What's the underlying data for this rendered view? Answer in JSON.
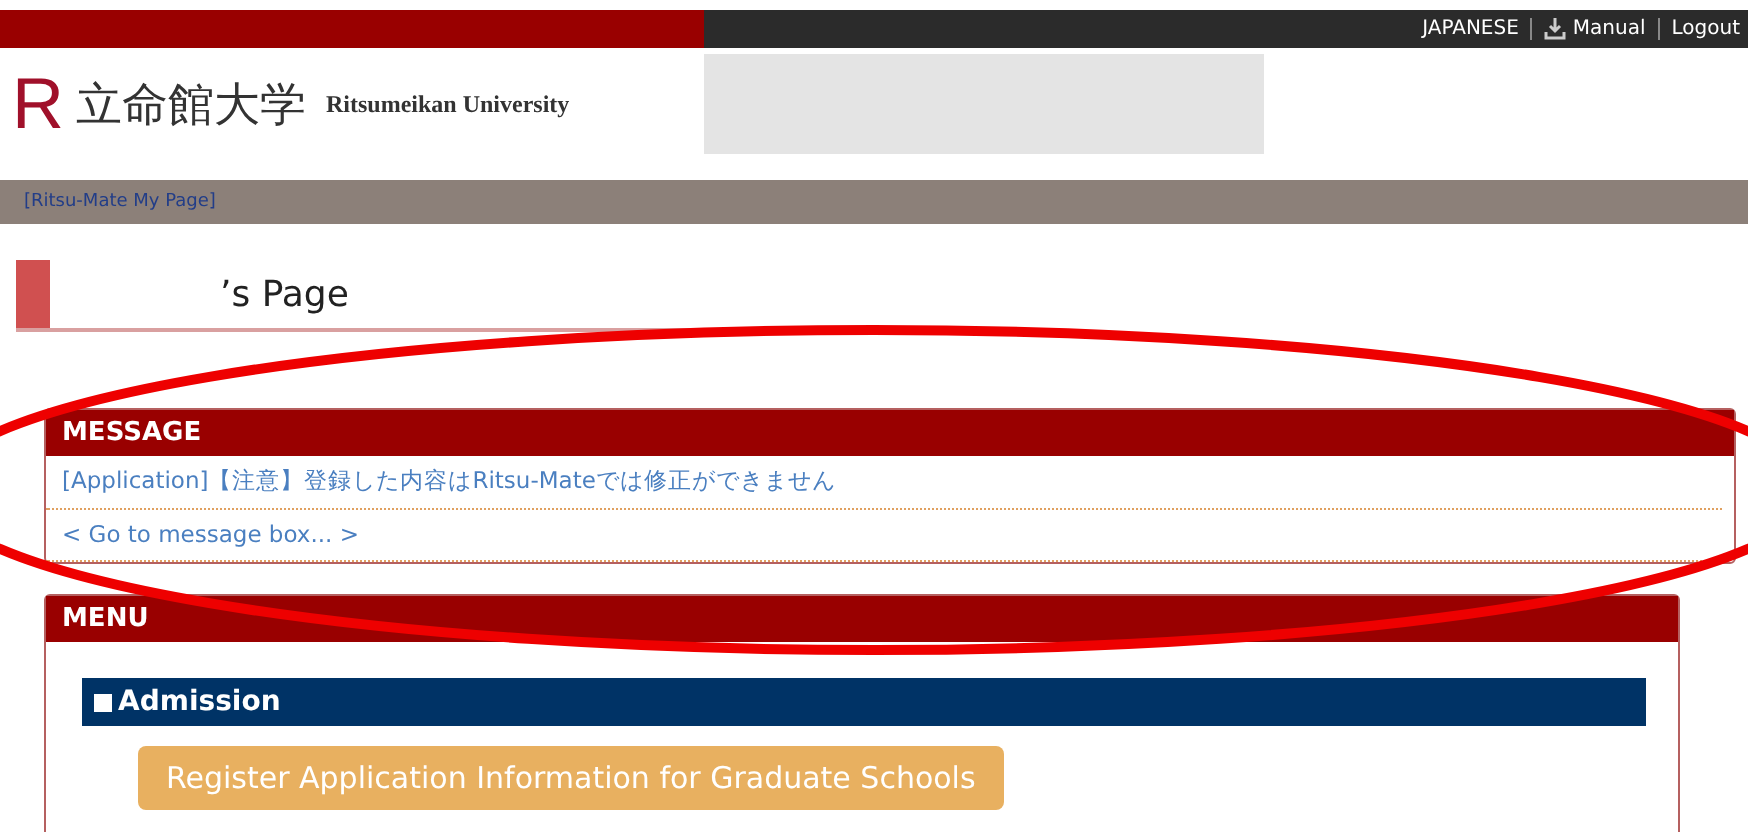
{
  "top_bar": {
    "links": [
      {
        "label": "JAPANESE",
        "kind": "text"
      },
      {
        "label": "Manual",
        "kind": "download"
      },
      {
        "label": "Logout",
        "kind": "text"
      }
    ]
  },
  "header": {
    "logo_mark": "R",
    "logo_name": "立命館大学",
    "logo_subtitle": "Ritsumeikan University"
  },
  "breadcrumb": "[Ritsu-Mate My Page]",
  "page_title": "’s Page",
  "message_panel": {
    "title": "MESSAGE",
    "messages": [
      "[Application]【注意】登録した内容はRitsu-Mateでは修正ができません"
    ],
    "more_link": "< Go to message box... >"
  },
  "menu_panel": {
    "title": "MENU",
    "sections": [
      {
        "title": "Admission",
        "buttons": [
          "Register Application Information for Graduate Schools"
        ]
      }
    ]
  }
}
